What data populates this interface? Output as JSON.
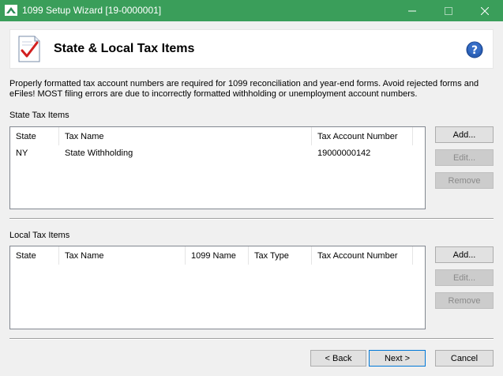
{
  "window": {
    "title": "1099 Setup Wizard [19-0000001]"
  },
  "header": {
    "title": "State & Local Tax Items"
  },
  "intro": {
    "text": "Properly formatted tax account numbers are required for 1099 reconciliation and year-end forms. Avoid rejected forms and eFiles! MOST filing errors are due to incorrectly formatted withholding or unemployment account numbers."
  },
  "state_section": {
    "label": "State Tax Items",
    "columns": [
      "State",
      "Tax Name",
      "Tax Account Number"
    ],
    "rows": [
      {
        "state": "NY",
        "tax_name": "State Withholding",
        "account": "19000000142"
      }
    ],
    "buttons": {
      "add": "Add...",
      "edit": "Edit...",
      "remove": "Remove"
    }
  },
  "local_section": {
    "label": "Local Tax Items",
    "columns": [
      "State",
      "Tax Name",
      "1099 Name",
      "Tax Type",
      "Tax Account Number"
    ],
    "rows": [],
    "buttons": {
      "add": "Add...",
      "edit": "Edit...",
      "remove": "Remove"
    }
  },
  "footer": {
    "back": "< Back",
    "next": "Next >",
    "cancel": "Cancel"
  },
  "colors": {
    "titlebar": "#3a9e5a",
    "accent": "#0078d7"
  }
}
